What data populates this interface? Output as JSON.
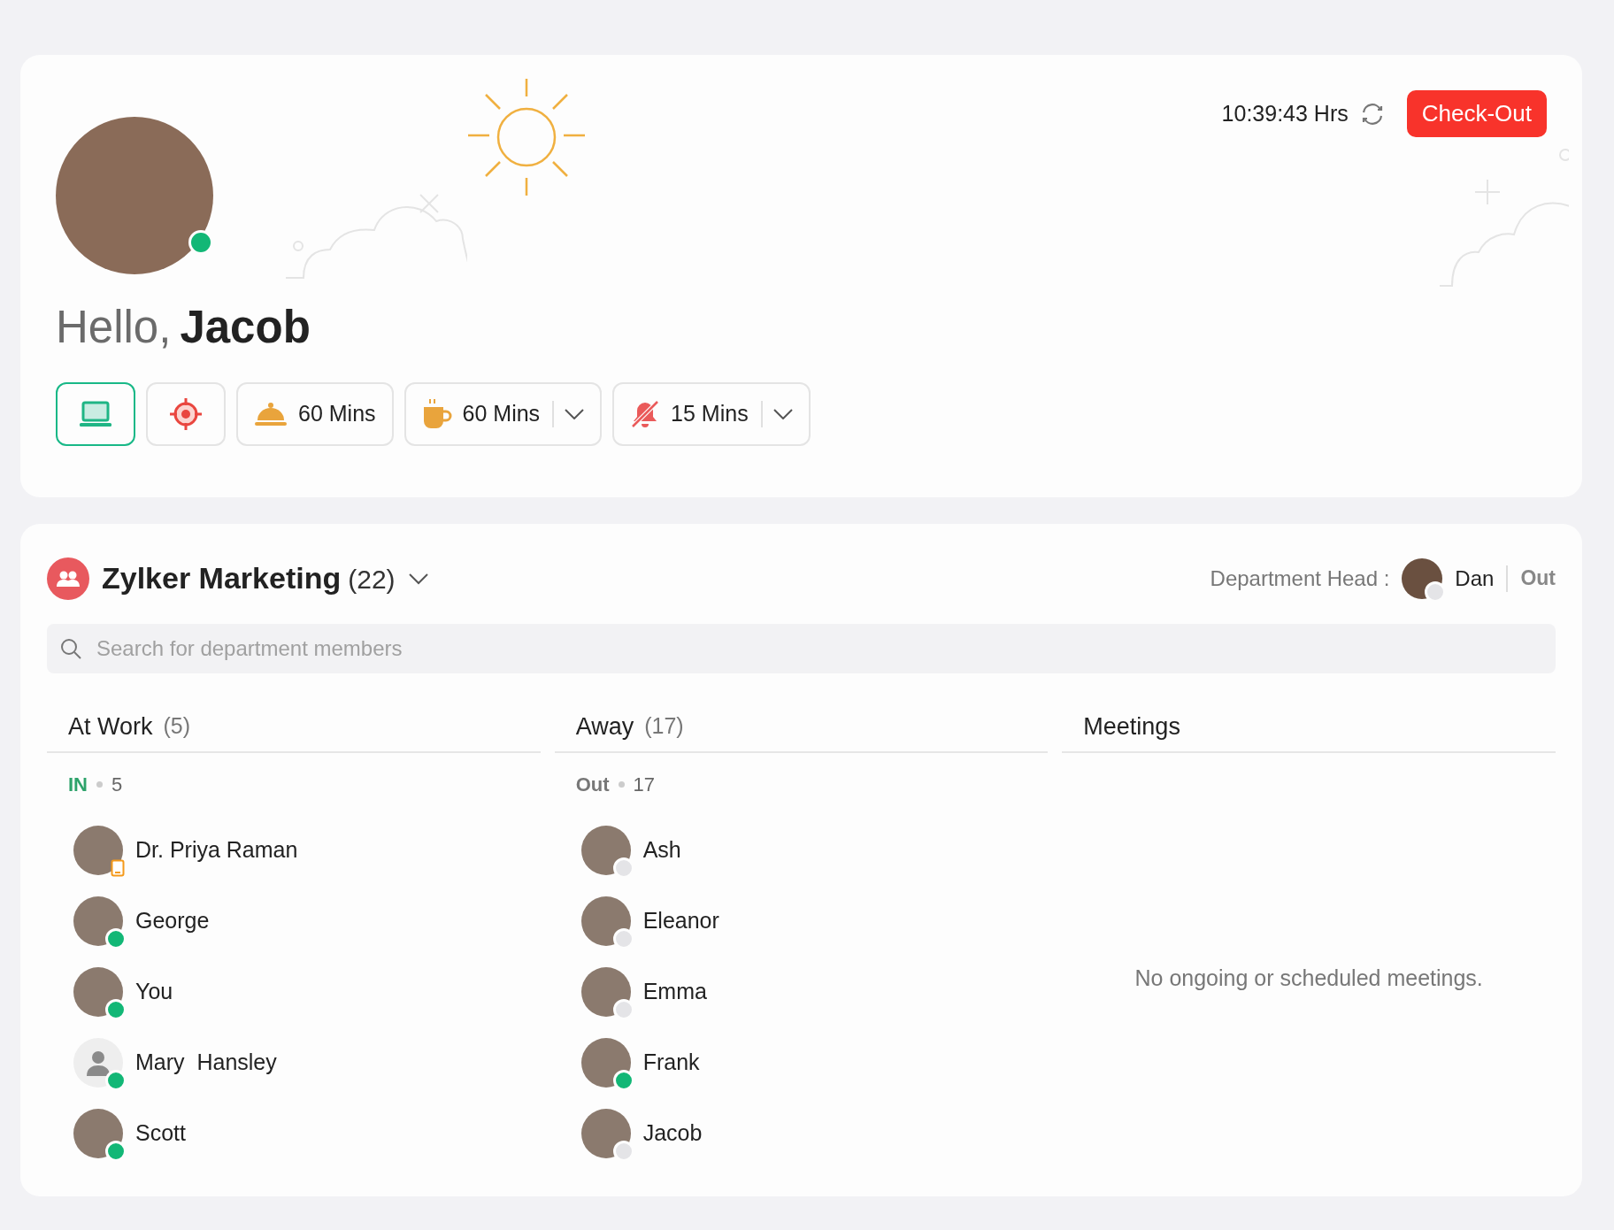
{
  "greeting": {
    "hello": "Hello,",
    "name": "Jacob",
    "online": true
  },
  "timer": {
    "time": "10:39:43 Hrs",
    "button": "Check-Out"
  },
  "status_buttons": [
    {
      "kind": "laptop",
      "selected": true,
      "dropdown": false
    },
    {
      "kind": "target",
      "selected": false,
      "dropdown": false
    },
    {
      "kind": "meal",
      "label": "60 Mins",
      "selected": false,
      "dropdown": false
    },
    {
      "kind": "coffee",
      "label": "60 Mins",
      "selected": false,
      "dropdown": true
    },
    {
      "kind": "mute",
      "label": "15 Mins",
      "selected": false,
      "dropdown": true
    }
  ],
  "department": {
    "name": "Zylker Marketing",
    "count": "(22)",
    "head_label": "Department Head :",
    "head_name": "Dan",
    "head_online": false,
    "head_state": "Out"
  },
  "search": {
    "placeholder": "Search for department members"
  },
  "columns": [
    {
      "title": "At Work",
      "count": "(5)",
      "group": {
        "label": "IN",
        "kind": "in",
        "count": "5"
      },
      "members": [
        {
          "name": "Dr. Priya Raman",
          "kind": "photo",
          "online": false,
          "mobile": true
        },
        {
          "name": "George",
          "kind": "photo",
          "online": true,
          "mobile": false
        },
        {
          "name": "You",
          "kind": "photo",
          "online": true,
          "mobile": false
        },
        {
          "name": "Mary  Hansley",
          "kind": "silhouette",
          "online": true,
          "mobile": false
        },
        {
          "name": "Scott",
          "kind": "photo",
          "online": true,
          "mobile": false
        }
      ]
    },
    {
      "title": "Away",
      "count": "(17)",
      "group": {
        "label": "Out",
        "kind": "out",
        "count": "17"
      },
      "members": [
        {
          "name": "Ash",
          "kind": "photo",
          "online": false,
          "mobile": false
        },
        {
          "name": "Eleanor",
          "kind": "photo",
          "online": false,
          "mobile": false
        },
        {
          "name": "Emma",
          "kind": "photo",
          "online": false,
          "mobile": false
        },
        {
          "name": "Frank",
          "kind": "photo",
          "online": true,
          "mobile": false
        },
        {
          "name": "Jacob",
          "kind": "photo",
          "online": false,
          "mobile": false
        }
      ]
    },
    {
      "title": "Meetings",
      "empty": "No ongoing or scheduled meetings."
    }
  ]
}
